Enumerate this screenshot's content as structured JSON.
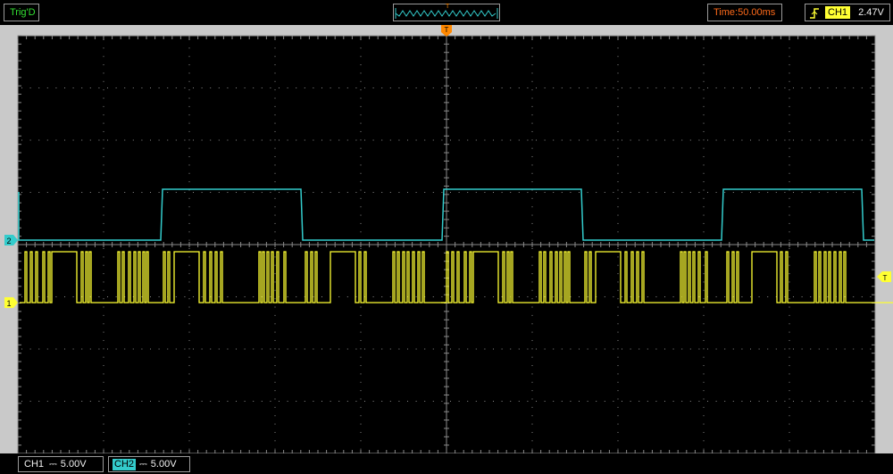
{
  "topbar": {
    "trigger_status": "Trig'D",
    "timebase": "Time:50.00ms",
    "trigger_source": "CH1",
    "trigger_level": "2.47V",
    "mini_marker": "T"
  },
  "markers": {
    "trigger_time": "T",
    "trigger_level": "T",
    "ch1": "1",
    "ch2": "2"
  },
  "bottombar": {
    "ch1_label": "CH1",
    "ch1_scale": "5.00V",
    "ch2_label": "CH2",
    "ch2_scale": "5.00V",
    "coupling_symbol": "⎓"
  },
  "colors": {
    "ch1": "#ffff33",
    "ch2": "#33cccc",
    "grid": "#8a8a8a",
    "trigger": "#ff8800"
  },
  "traces": {
    "ch2_transitions": [
      180,
      337,
      495,
      651,
      808,
      965
    ],
    "ch1_bursts": [
      {
        "start": 28,
        "pulses": [
          [
            0,
            2
          ],
          [
            6,
            2
          ],
          [
            12,
            2
          ],
          [
            20,
            2
          ],
          [
            26,
            2
          ],
          [
            30,
            28
          ],
          [
            63,
            2
          ],
          [
            68,
            2
          ],
          [
            72,
            2
          ]
        ]
      },
      {
        "start": 132,
        "pulses": [
          [
            0,
            2
          ],
          [
            5,
            2
          ],
          [
            12,
            2
          ],
          [
            18,
            2
          ],
          [
            23,
            2
          ],
          [
            28,
            2
          ],
          [
            32,
            2
          ]
        ]
      },
      {
        "start": 183,
        "pulses": [
          [
            0,
            2
          ],
          [
            5,
            2
          ],
          [
            12,
            28
          ],
          [
            45,
            2
          ],
          [
            52,
            2
          ],
          [
            58,
            2
          ],
          [
            64,
            2
          ]
        ]
      },
      {
        "start": 290,
        "pulses": [
          [
            0,
            2
          ],
          [
            4,
            2
          ],
          [
            9,
            2
          ],
          [
            14,
            2
          ],
          [
            20,
            2
          ],
          [
            28,
            2
          ]
        ]
      },
      {
        "start": 342,
        "pulses": [
          [
            0,
            2
          ],
          [
            6,
            2
          ],
          [
            11,
            2
          ],
          [
            28,
            28
          ],
          [
            60,
            2
          ],
          [
            66,
            2
          ]
        ]
      },
      {
        "start": 440,
        "pulses": [
          [
            0,
            2
          ],
          [
            5,
            2
          ],
          [
            11,
            2
          ],
          [
            16,
            2
          ],
          [
            22,
            2
          ],
          [
            28,
            2
          ],
          [
            33,
            2
          ]
        ]
      }
    ]
  }
}
